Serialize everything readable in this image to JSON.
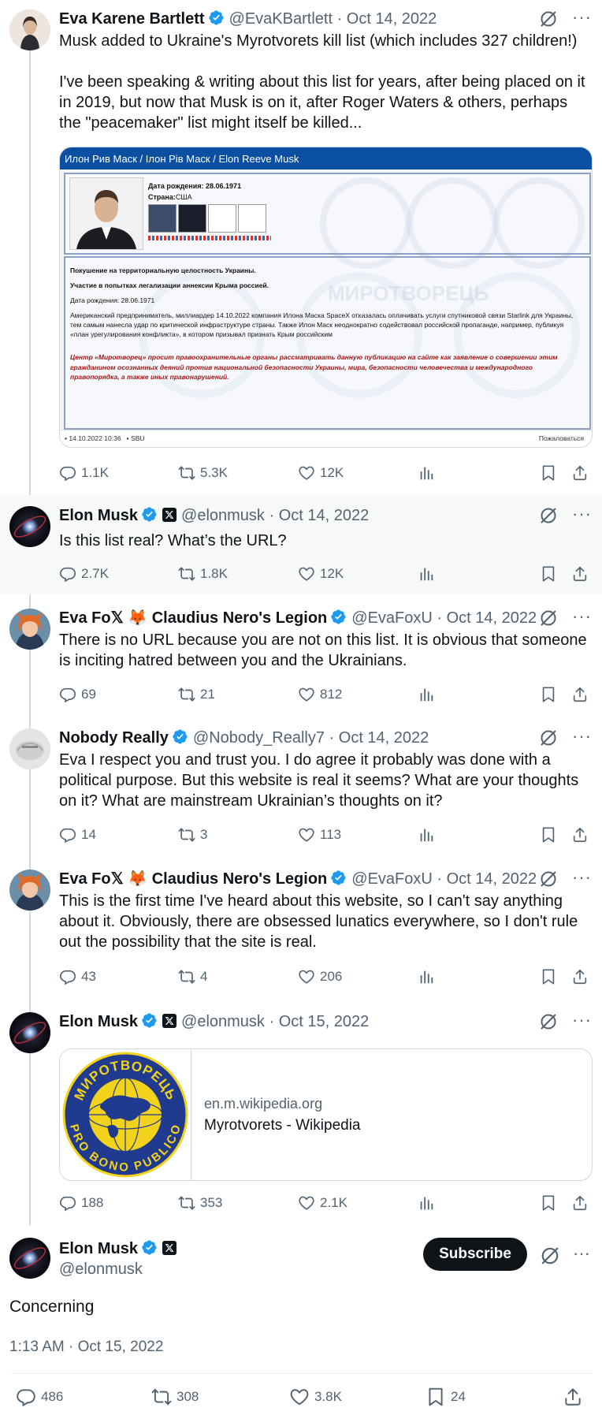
{
  "tweets": [
    {
      "name": "Eva Karene Bartlett",
      "handle": "@EvaKBartlett",
      "date": "· Oct 14, 2022",
      "text": "Musk added to Ukraine's Myrotvorets kill list (which includes 327 children!)\n\nI've been speaking & writing about this list for years, after being placed on it in 2019, but now that Musk is on it, after Roger Waters & others, perhaps the \"peacemaker\" list might itself be killed...",
      "replies": "1.1K",
      "reposts": "5.3K",
      "likes": "12K"
    },
    {
      "name": "Elon Musk",
      "handle": "@elonmusk",
      "date": "· Oct 14, 2022",
      "text": "Is this list real? What’s the URL?",
      "replies": "2.7K",
      "reposts": "1.8K",
      "likes": "12K"
    },
    {
      "name": "Eva Fo𝕏 🦊 Claudius Nero's Legion",
      "handle": "@EvaFoxU",
      "date": "· Oct 14, 2022",
      "text": "There is no URL because you are not on this list. It is obvious that someone is inciting hatred between you and the Ukrainians.",
      "replies": "69",
      "reposts": "21",
      "likes": "812"
    },
    {
      "name": "Nobody Really",
      "handle": "@Nobody_Really7",
      "date": "· Oct 14, 2022",
      "text": "Eva I respect you and trust you. I do agree it probably was done with a political purpose. But this website is real it seems? What are your thoughts on it? What are mainstream Ukrainian’s thoughts on it?",
      "replies": "14",
      "reposts": "3",
      "likes": "113"
    },
    {
      "name": "Eva Fo𝕏 🦊 Claudius Nero's Legion",
      "handle": "@EvaFoxU",
      "date": "· Oct 14, 2022",
      "text": "This is the first time I've heard about this website, so I can't say anything about it. Obviously, there are obsessed lunatics everywhere, so I don't rule out the possibility that the site is real.",
      "replies": "43",
      "reposts": "4",
      "likes": "206"
    },
    {
      "name": "Elon Musk",
      "handle": "@elonmusk",
      "date": "· Oct 15, 2022",
      "replies": "188",
      "reposts": "353",
      "likes": "2.1K",
      "card": {
        "domain": "en.m.wikipedia.org",
        "title": "Myrotvorets - Wikipedia"
      }
    }
  ],
  "embedded_image": {
    "header": "Илон Рив Маск / Ілон Рів Маск / Elon Reeve Musk",
    "birth": "Дата рождения: 28.06.1971",
    "country_label": "Страна:",
    "country": "США",
    "p1": "Покушение на территориальную целостность Украины.",
    "p2": "Участие в попытках легализации аннексии Крыма россией.",
    "p3": "Дата рождения: 28.06.1971",
    "p4": "Американский предприниматель, миллиардер 14.10.2022 компания Илона Маска SpaceX отказалась оплачивать услуги спутниковой связи Starlink для Украины, тем самым нанесла удар по критической инфраструктуре страны. Также Илон Маск неоднократно содействовал российской пропаганде, например, публикуя «план урегулирования конфликта», в котором призывал признать Крым российским",
    "p5": "Центр «Миротворец» просит правоохранительные органы рассматривать данную публикацию на сайте как заявление о совершении этим гражданином осознанных деяний против национальной безопасности Украины, мира, безопасности человечества и международного правопорядка, а также иных правонарушений.",
    "footer_left": "14.10.2022 10:36",
    "footer_src": "SBU",
    "footer_right": "Пожаловаться",
    "seal_text": "МИРОТВОРЕЦЬ"
  },
  "seal": {
    "top": "МИРОТВОРЕЦЬ",
    "bottom": "PRO BONO PUBLICO"
  },
  "main_tweet": {
    "name": "Elon Musk",
    "handle": "@elonmusk",
    "subscribe": "Subscribe",
    "text": "Concerning",
    "timestamp": "1:13 AM · Oct 15, 2022",
    "replies": "486",
    "reposts": "308",
    "likes": "3.8K",
    "bookmarks": "24"
  },
  "colors": {
    "verified": "#1d9bf0",
    "text": "#0f1419",
    "muted": "#536471",
    "border": "#cfd9de"
  }
}
